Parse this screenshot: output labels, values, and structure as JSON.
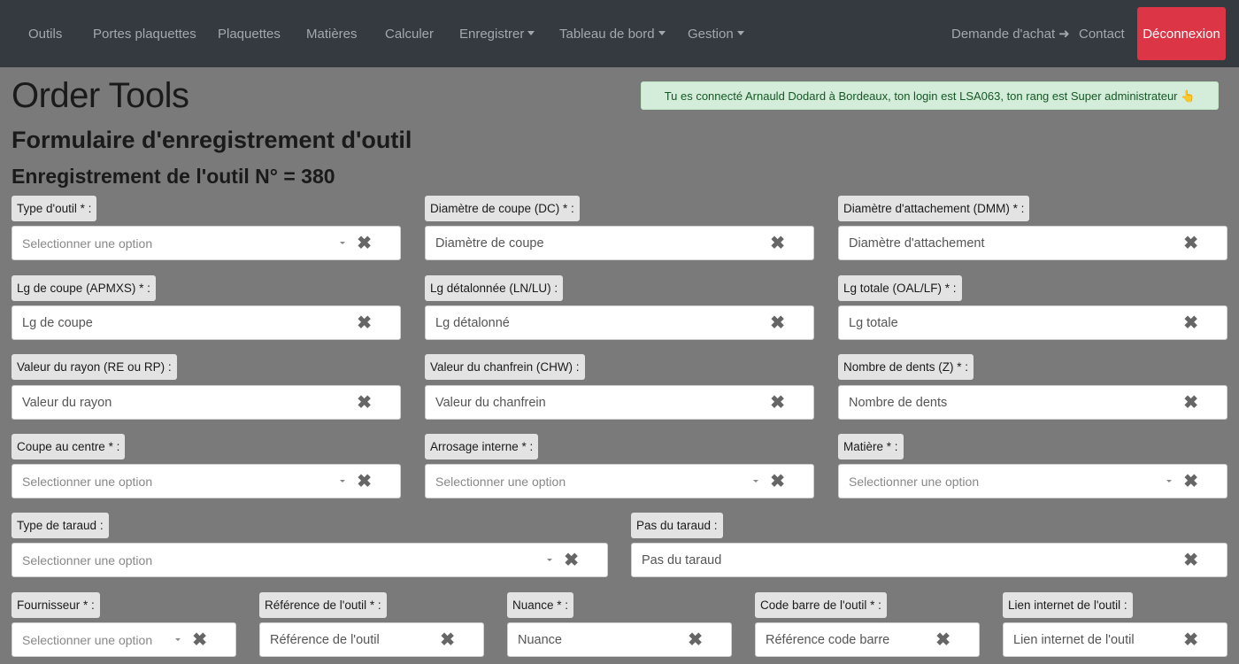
{
  "nav": {
    "items": [
      "Outils",
      "Portes plaquettes",
      "Plaquettes",
      "Matières",
      "Calculer",
      "Enregistrer",
      "Tableau de bord",
      "Gestion"
    ],
    "demande": "Demande d'achat",
    "contact": "Contact",
    "logout": "Déconnexion"
  },
  "header": {
    "title": "Order Tools",
    "subtitle": "Formulaire d'enregistrement d'outil",
    "record_prefix": "Enregistrement de l'outil N° =",
    "record_number": "380"
  },
  "alert": "Tu es connecté Arnauld Dodard à Bordeaux, ton login est LSA063, ton rang est Super administrateur 👆",
  "fields": {
    "type_outil": {
      "label": "Type d'outil * :",
      "placeholder": "Selectionner une option"
    },
    "diam_coupe": {
      "label": "Diamètre de coupe (DC) * :",
      "placeholder": "Diamètre de coupe"
    },
    "diam_attache": {
      "label": "Diamètre d'attachement (DMM) * :",
      "placeholder": "Diamètre d'attachement"
    },
    "lg_coupe": {
      "label": "Lg de coupe (APMXS) * :",
      "placeholder": "Lg de coupe"
    },
    "lg_detal": {
      "label": "Lg détalonnée (LN/LU) :",
      "placeholder": "Lg détalonné"
    },
    "lg_totale": {
      "label": "Lg totale (OAL/LF) * :",
      "placeholder": "Lg totale"
    },
    "rayon": {
      "label": "Valeur du rayon (RE ou RP) :",
      "placeholder": "Valeur du rayon"
    },
    "chanfrein": {
      "label": "Valeur du chanfrein (CHW) :",
      "placeholder": "Valeur du chanfrein"
    },
    "dents": {
      "label": "Nombre de dents (Z) * :",
      "placeholder": "Nombre de dents"
    },
    "coupe_centre": {
      "label": "Coupe au centre * :",
      "placeholder": "Selectionner une option"
    },
    "arrosage": {
      "label": "Arrosage interne * :",
      "placeholder": "Selectionner une option"
    },
    "matiere": {
      "label": "Matière * :",
      "placeholder": "Selectionner une option"
    },
    "type_taraud": {
      "label": "Type de taraud :",
      "placeholder": "Selectionner une option"
    },
    "pas_taraud": {
      "label": "Pas du taraud :",
      "placeholder": "Pas du taraud"
    },
    "fournisseur": {
      "label": "Fournisseur * :",
      "placeholder": "Selectionner une option"
    },
    "reference": {
      "label": "Référence de l'outil * :",
      "placeholder": "Référence de l'outil"
    },
    "nuance": {
      "label": "Nuance * :",
      "placeholder": "Nuance"
    },
    "code_barre": {
      "label": "Code barre de l'outil * :",
      "placeholder": "Référence code barre"
    },
    "lien": {
      "label": "Lien internet de l'outil :",
      "placeholder": "Lien internet de l'outil"
    }
  },
  "icons": {
    "clear": "✖",
    "hand": "pointing-hand-icon"
  },
  "colors": {
    "navbar": "#343a40",
    "logout": "#dc3545",
    "alert_bg": "#d4edda",
    "alert_text": "#155724",
    "page_bg": "#7a7a7a"
  }
}
